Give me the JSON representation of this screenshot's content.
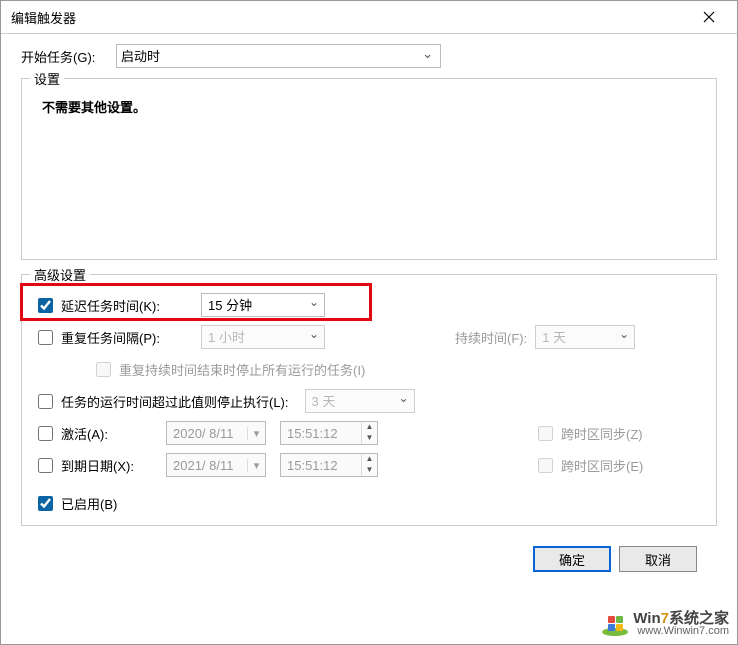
{
  "window": {
    "title": "编辑触发器"
  },
  "start_task": {
    "label": "开始任务(G):",
    "value": "启动时"
  },
  "settings": {
    "legend": "设置",
    "no_settings": "不需要其他设置。"
  },
  "advanced": {
    "legend": "高级设置",
    "delay": {
      "label": "延迟任务时间(K):",
      "value": "15 分钟",
      "checked": true
    },
    "repeat": {
      "label": "重复任务间隔(P):",
      "value": "1 小时",
      "duration_label": "持续时间(F):",
      "duration_value": "1 天",
      "checked": false
    },
    "stop_at_end": {
      "label": "重复持续时间结束时停止所有运行的任务(I)",
      "checked": false
    },
    "stop_longer": {
      "label": "任务的运行时间超过此值则停止执行(L):",
      "value": "3 天",
      "checked": false
    },
    "activate": {
      "label": "激活(A):",
      "date": "2020/ 8/11",
      "time": "15:51:12",
      "sync_label": "跨时区同步(Z)",
      "checked": false
    },
    "expire": {
      "label": "到期日期(X):",
      "date": "2021/ 8/11",
      "time": "15:51:12",
      "sync_label": "跨时区同步(E)",
      "checked": false
    },
    "enabled": {
      "label": "已启用(B)",
      "checked": true
    }
  },
  "buttons": {
    "ok": "确定",
    "cancel": "取消"
  },
  "watermark": {
    "brand_pre": "W",
    "brand_mid": "in",
    "brand_suf": "7",
    "brand_tail": "系统之家",
    "url": "www.Winwin7.com"
  }
}
